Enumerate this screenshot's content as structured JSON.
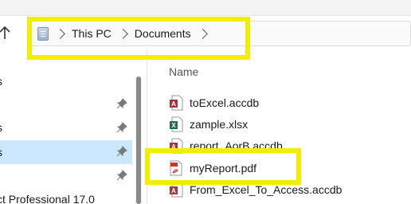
{
  "address_bar": {
    "location_icon": "this-pc-icon",
    "breadcrumbs": [
      {
        "label": "This PC"
      },
      {
        "label": "Documents"
      }
    ]
  },
  "nav_pane": {
    "items": [
      {
        "label": "s",
        "pinned": false,
        "selected": false
      },
      {
        "label": "",
        "pinned": true,
        "selected": false
      },
      {
        "label": "s",
        "pinned": true,
        "selected": false
      },
      {
        "label": "s",
        "pinned": true,
        "selected": true
      },
      {
        "label": "",
        "pinned": true,
        "selected": false
      },
      {
        "label": "ct Professional 17.0",
        "pinned": false,
        "selected": false
      }
    ]
  },
  "file_list": {
    "column_name": "Name",
    "files": [
      {
        "name": "toExcel.accdb",
        "icon": "access-file-icon"
      },
      {
        "name": "zample.xlsx",
        "icon": "excel-file-icon"
      },
      {
        "name": "report_AorB.accdb",
        "icon": "access-file-icon"
      },
      {
        "name": "myReport.pdf",
        "icon": "pdf-file-icon"
      },
      {
        "name": "From_Excel_To_Access.accdb",
        "icon": "access-file-icon"
      }
    ]
  },
  "colors": {
    "highlight": "#f2ee00",
    "selected_bg": "#cce8ff",
    "access_red": "#a4373a",
    "excel_green": "#217346",
    "pdf_red": "#d93025"
  }
}
